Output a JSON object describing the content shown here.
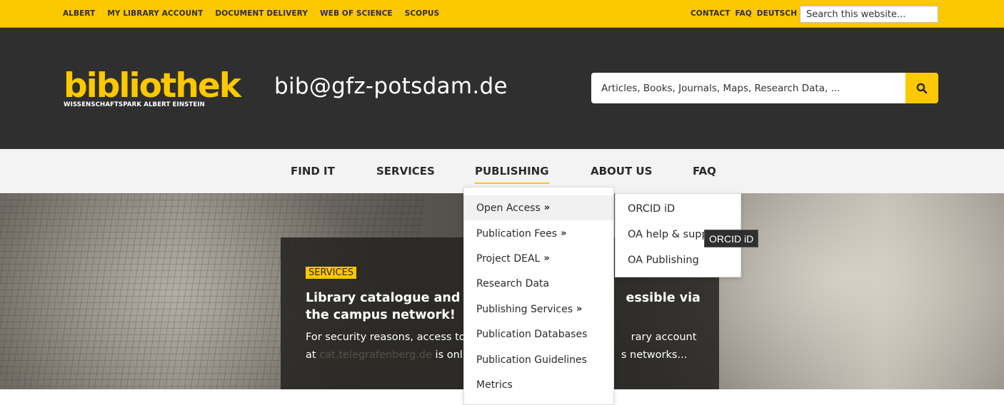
{
  "topbar": {
    "links": [
      "ALBERT",
      "MY LIBRARY ACCOUNT",
      "DOCUMENT DELIVERY",
      "WEB OF SCIENCE",
      "SCOPUS"
    ],
    "right_links": [
      "CONTACT",
      "FAQ",
      "DEUTSCH"
    ],
    "search_placeholder": "Search this website..."
  },
  "header": {
    "logo_word": "bibliothek",
    "logo_sub": "WISSENSCHAFTSPARK ALBERT EINSTEIN",
    "email": "bib@gfz-potsdam.de",
    "search_placeholder": "Articles, Books, Journals, Maps, Research Data, ...",
    "search_icon": "search-icon"
  },
  "nav": {
    "items": [
      "FIND IT",
      "SERVICES",
      "PUBLISHING",
      "ABOUT US",
      "FAQ"
    ],
    "active": "PUBLISHING"
  },
  "hero": {
    "tag": "SERVICES",
    "title_a": "Library catalogue and li",
    "title_b": "essible via",
    "title_c": "the campus network!",
    "text_a": "For security reasons, access to",
    "text_b": "rary account",
    "text_c": "at",
    "text_link": "cat.telegrafenberg.de",
    "text_d": "is onl",
    "text_e": "s networks..."
  },
  "dropdown": {
    "items": [
      {
        "label": "Open Access",
        "arrow": "»"
      },
      {
        "label": "Publication Fees",
        "arrow": "»"
      },
      {
        "label": "Project DEAL",
        "arrow": "»"
      },
      {
        "label": "Research Data",
        "arrow": ""
      },
      {
        "label": "Publishing Services",
        "arrow": "»"
      },
      {
        "label": "Publication Databases",
        "arrow": ""
      },
      {
        "label": "Publication Guidelines",
        "arrow": ""
      },
      {
        "label": "Metrics",
        "arrow": ""
      }
    ]
  },
  "submenu": {
    "items": [
      "ORCID iD",
      "OA help & supp",
      "OA Publishing"
    ]
  },
  "tooltip": "ORCID iD",
  "colors": {
    "accent": "#fcc800",
    "header_bg": "#2f2f2f",
    "nav_bg": "#f3f3f3"
  }
}
